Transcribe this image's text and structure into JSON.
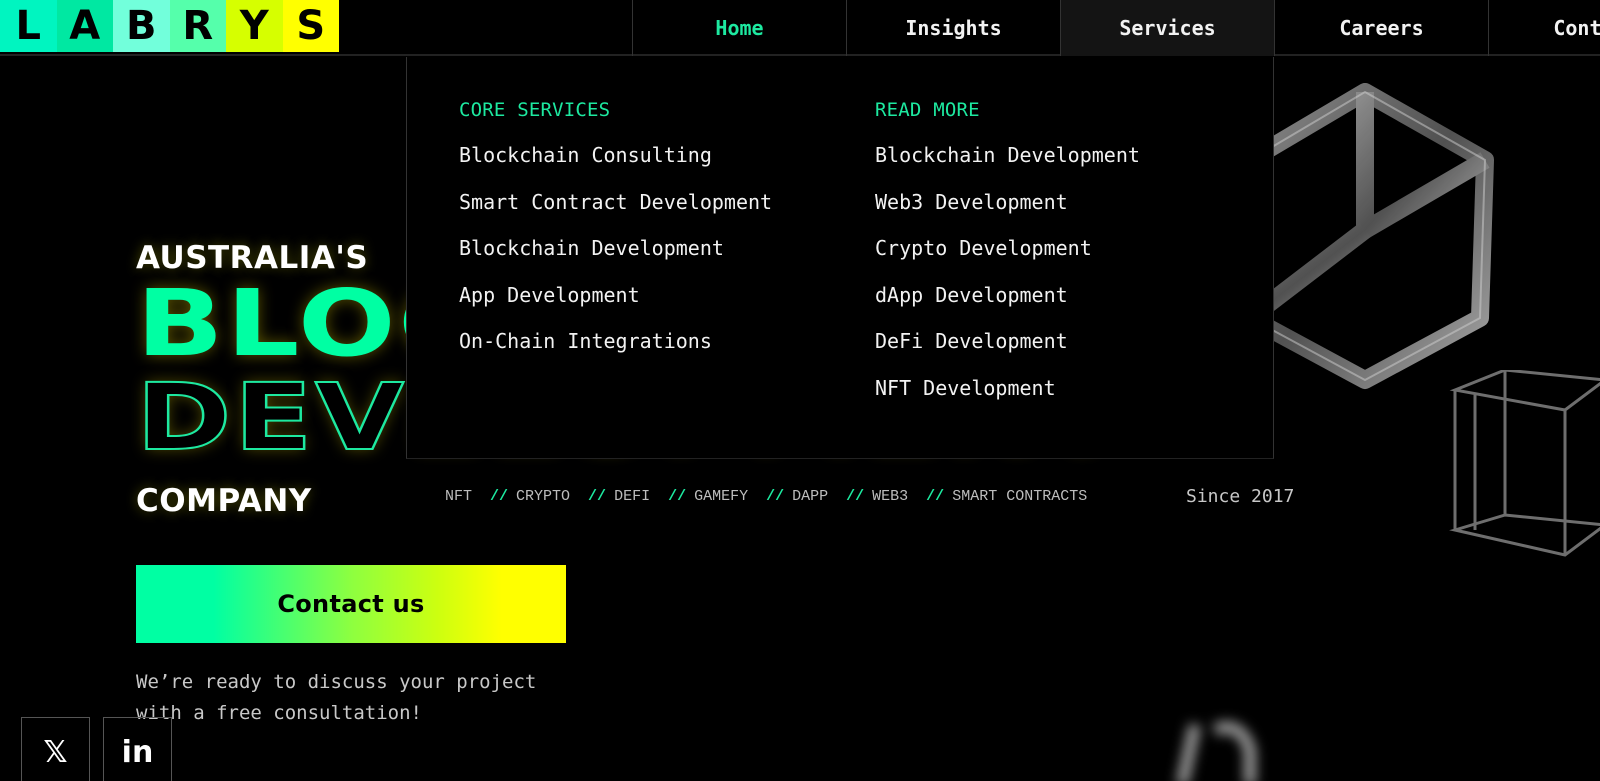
{
  "logo": {
    "letters": [
      "L",
      "A",
      "B",
      "R",
      "Y",
      "S"
    ],
    "tile_colors": [
      "#00f5c0",
      "#00e8a2",
      "#72ffdb",
      "#55ffab",
      "#d6ff00",
      "#ffff00"
    ]
  },
  "nav": {
    "items": [
      {
        "label": "Home",
        "state": "active"
      },
      {
        "label": "Insights",
        "state": ""
      },
      {
        "label": "Services",
        "state": "open"
      },
      {
        "label": "Careers",
        "state": ""
      },
      {
        "label": "Contact",
        "state": ""
      }
    ]
  },
  "dropdown": {
    "core_heading": "CORE SERVICES",
    "core_items": [
      "Blockchain Consulting",
      "Smart Contract Development",
      "Blockchain Development",
      "App Development",
      "On-Chain Integrations"
    ],
    "more_heading": "READ MORE",
    "more_items": [
      "Blockchain Development",
      "Web3 Development",
      "Crypto Development",
      "dApp Development",
      "DeFi Development",
      "NFT Development"
    ]
  },
  "hero": {
    "line1": "AUSTRALIA'S",
    "line2": "BLOCKCHAIN",
    "line3": "DEVELOPMENT",
    "line4": "COMPANY",
    "tags": [
      "NFT",
      "CRYPTO",
      "DEFI",
      "GAMEFY",
      "DAPP",
      "WEB3",
      "SMART CONTRACTS"
    ],
    "tag_separator": "//",
    "since": "Since 2017",
    "cta_label": "Contact us",
    "consult_text": "We’re ready to discuss your project with a free consultation!"
  },
  "social": {
    "x_label": "𝕏",
    "linkedin_label": "in"
  },
  "colors": {
    "accent": "#1de9a0",
    "bright_green": "#00ffa3",
    "yellow": "#ffff00",
    "background": "#000000"
  }
}
